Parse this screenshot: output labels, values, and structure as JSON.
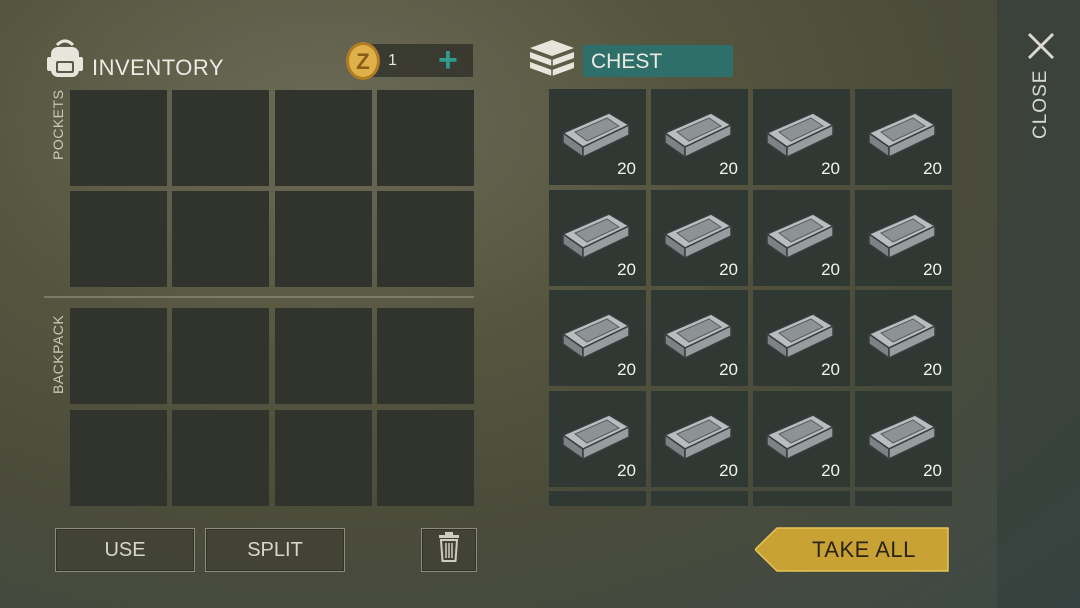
{
  "inventory": {
    "title": "INVENTORY",
    "currency_amount": "1",
    "add_symbol": "+",
    "pockets_label": "POCKETS",
    "backpack_label": "BACKPACK"
  },
  "chest": {
    "title": "CHEST",
    "items": [
      {
        "name": "metal-ingot",
        "qty": "20"
      },
      {
        "name": "metal-ingot",
        "qty": "20"
      },
      {
        "name": "metal-ingot",
        "qty": "20"
      },
      {
        "name": "metal-ingot",
        "qty": "20"
      },
      {
        "name": "metal-ingot",
        "qty": "20"
      },
      {
        "name": "metal-ingot",
        "qty": "20"
      },
      {
        "name": "metal-ingot",
        "qty": "20"
      },
      {
        "name": "metal-ingot",
        "qty": "20"
      },
      {
        "name": "metal-ingot",
        "qty": "20"
      },
      {
        "name": "metal-ingot",
        "qty": "20"
      },
      {
        "name": "metal-ingot",
        "qty": "20"
      },
      {
        "name": "metal-ingot",
        "qty": "20"
      },
      {
        "name": "metal-ingot",
        "qty": "20"
      },
      {
        "name": "metal-ingot",
        "qty": "20"
      },
      {
        "name": "metal-ingot",
        "qty": "20"
      },
      {
        "name": "metal-ingot",
        "qty": "20"
      }
    ]
  },
  "buttons": {
    "use": "USE",
    "split": "SPLIT",
    "take_all": "TAKE ALL",
    "close": "CLOSE"
  },
  "colors": {
    "chest_title_bg": "#2f6f69",
    "take_all_bg": "#c9a235",
    "take_all_text": "#2a2410",
    "add_plus": "#2f9c8e",
    "coin": "#d4a23a"
  },
  "icons": {
    "backpack": "backpack-icon",
    "coin": "coin-icon",
    "chest": "chest-icon",
    "trash": "trash-icon",
    "close": "close-icon",
    "ingot": "metal-ingot-icon"
  }
}
